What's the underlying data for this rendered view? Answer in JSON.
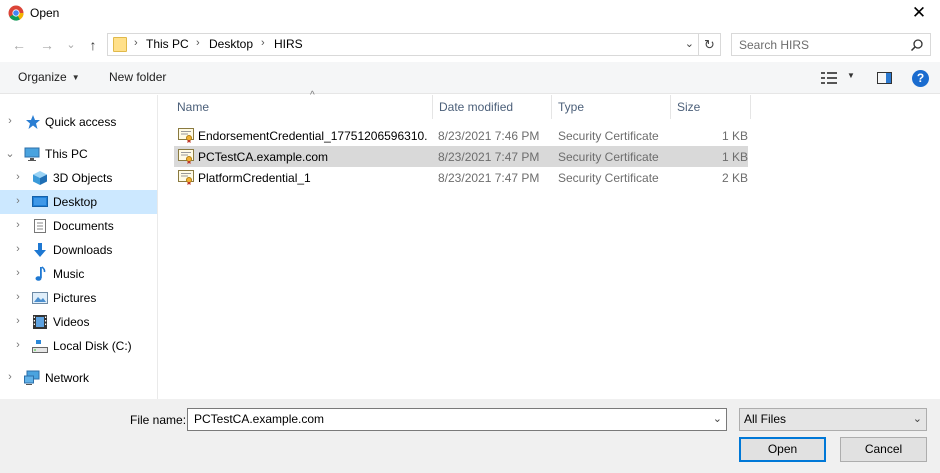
{
  "window": {
    "title": "Open",
    "app_icon": "chrome-icon",
    "close_glyph": "✕"
  },
  "nav": {
    "back_glyph": "←",
    "forward_glyph": "→",
    "recent_glyph": "⌄",
    "up_glyph": "↑"
  },
  "address": {
    "crumbs": [
      "This PC",
      "Desktop",
      "HIRS"
    ],
    "separator": "›",
    "dropdown_glyph": "⌄",
    "refresh_glyph": "↻"
  },
  "search": {
    "placeholder": "Search HIRS",
    "icon": "search-icon"
  },
  "toolbar": {
    "organize_label": "Organize",
    "organize_caret": "▼",
    "new_folder_label": "New folder",
    "view_caret": "▼",
    "help_glyph": "?"
  },
  "sidebar": {
    "expander_collapsed": "›",
    "expander_expanded": "⌄",
    "items": [
      {
        "label": "Quick access",
        "icon": "star-icon"
      },
      {
        "label": "This PC",
        "icon": "computer-icon"
      },
      {
        "label": "3D Objects",
        "icon": "cube-icon"
      },
      {
        "label": "Desktop",
        "icon": "desktop-icon",
        "selected": true
      },
      {
        "label": "Documents",
        "icon": "document-icon"
      },
      {
        "label": "Downloads",
        "icon": "download-icon"
      },
      {
        "label": "Music",
        "icon": "music-icon"
      },
      {
        "label": "Pictures",
        "icon": "pictures-icon"
      },
      {
        "label": "Videos",
        "icon": "video-icon"
      },
      {
        "label": "Local Disk (C:)",
        "icon": "drive-icon"
      },
      {
        "label": "Network",
        "icon": "network-icon"
      }
    ]
  },
  "filelist": {
    "sort_glyph": "^",
    "columns": [
      "Name",
      "Date modified",
      "Type",
      "Size"
    ],
    "rows": [
      {
        "name": "EndorsementCredential_17751206596310...",
        "date": "8/23/2021 7:46 PM",
        "type": "Security Certificate",
        "size": "1 KB"
      },
      {
        "name": "PCTestCA.example.com",
        "date": "8/23/2021 7:47 PM",
        "type": "Security Certificate",
        "size": "1 KB",
        "selected": true
      },
      {
        "name": "PlatformCredential_1",
        "date": "8/23/2021 7:47 PM",
        "type": "Security Certificate",
        "size": "2 KB"
      }
    ]
  },
  "bottom": {
    "file_name_label": "File name:",
    "file_name_value": "PCTestCA.example.com",
    "file_name_chevron": "⌄",
    "filter_value": "All Files",
    "filter_chevron": "⌄",
    "open_label": "Open",
    "cancel_label": "Cancel"
  },
  "colors": {
    "selection_blue": "#cce8ff",
    "row_selected_grey": "#d9d9d9",
    "header_text": "#4c607a",
    "accent": "#0078d7"
  }
}
